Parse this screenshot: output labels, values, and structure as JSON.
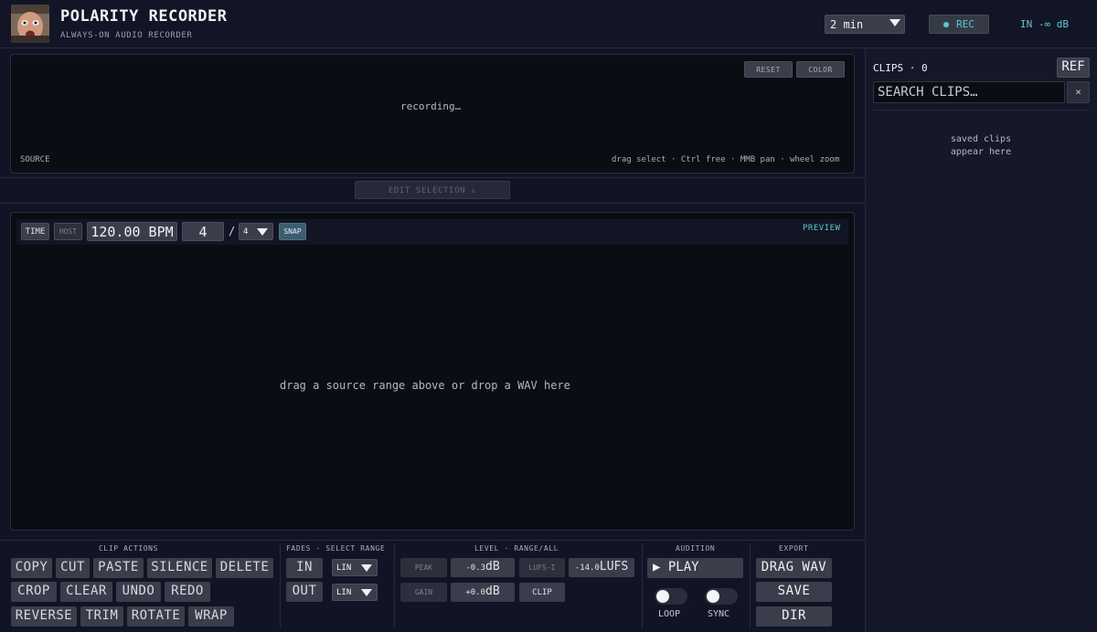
{
  "header": {
    "title": "POLARITY RECORDER",
    "subtitle": "ALWAYS-ON AUDIO RECORDER",
    "duration_value": "2 min",
    "rec_label": "REC",
    "input_meter": "IN -∞ dB"
  },
  "source": {
    "reset_label": "RESET",
    "color_label": "COLOR",
    "status": "recording…",
    "label": "SOURCE",
    "hint": "drag select · Ctrl free · MMB pan · wheel zoom",
    "edit_selection_label": "EDIT SELECTION ↓"
  },
  "editor": {
    "time_label": "TIME",
    "host_label": "HOST",
    "bpm": "120.00 BPM",
    "beats": "4",
    "slash": "/",
    "beat_unit": "4",
    "snap_label": "SNAP",
    "preview_label": "PREVIEW",
    "empty_text": "drag a source range above or drop a WAV here"
  },
  "clip_actions": {
    "heading": "CLIP ACTIONS",
    "buttons": [
      "COPY",
      "CUT",
      "PASTE",
      "SILENCE",
      "DELETE",
      "CROP",
      "CLEAR",
      "UNDO",
      "REDO",
      "REVERSE",
      "TRIM",
      "ROTATE",
      "WRAP"
    ]
  },
  "fades": {
    "heading": "FADES · SELECT RANGE",
    "in_label": "IN",
    "out_label": "OUT",
    "in_curve": "LIN",
    "out_curve": "LIN"
  },
  "level": {
    "heading": "LEVEL · RANGE/ALL",
    "peak_label": "PEAK",
    "peak_value": "-0.3",
    "peak_unit": "dB",
    "lufs_label": "LUFS-I",
    "lufs_value": "-14.0",
    "lufs_unit": "LUFS",
    "gain_label": "GAIN",
    "gain_value": "+0.0",
    "gain_unit": "dB",
    "clip_label": "CLIP"
  },
  "audition": {
    "heading": "AUDITION",
    "play_label": "PLAY",
    "loop_label": "LOOP",
    "sync_label": "SYNC"
  },
  "export": {
    "heading": "EXPORT",
    "drag_wav_label": "DRAG WAV",
    "save_label": "SAVE",
    "dir_label": "DIR"
  },
  "clips": {
    "count_label": "CLIPS · 0",
    "ref_label": "REF",
    "search_placeholder": "SEARCH CLIPS…",
    "clear_label": "×",
    "empty_line1": "saved clips",
    "empty_line2": "appear here"
  },
  "colors": {
    "accent": "#5fc8d1",
    "background": "#111424",
    "panel": "#0b0d15",
    "button": "#3a3e4b"
  }
}
